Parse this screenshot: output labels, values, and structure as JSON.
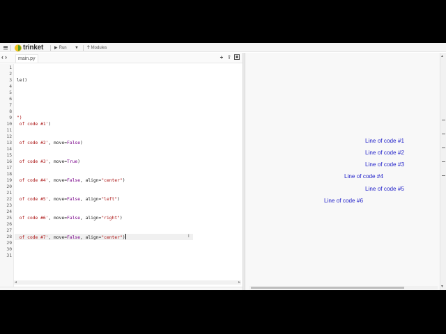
{
  "toolbar": {
    "menu_icon": "hamburger-icon",
    "logo_text": "trinket",
    "run_label": "Run",
    "run_icon": "play-icon",
    "dropdown_icon": "caret-down-icon",
    "modules_label": "Modules",
    "modules_icon": "question-icon"
  },
  "tabs": {
    "back_icon": "chevron-left-icon",
    "forward_icon": "chevron-right-icon",
    "file_name": "main.py",
    "add_icon": "plus-icon",
    "upload_icon": "upload-icon",
    "image_icon": "image-icon"
  },
  "editor": {
    "line_numbers": [
      "1",
      "2",
      "3",
      "4",
      "5",
      "6",
      "7",
      "8",
      "9",
      "10",
      "11",
      "12",
      "13",
      "14",
      "15",
      "16",
      "17",
      "18",
      "19",
      "20",
      "21",
      "22",
      "23",
      "24",
      "25",
      "26",
      "27",
      "28",
      "29",
      "30",
      "31"
    ],
    "lines": {
      "l3": "le()",
      "l9": "\")",
      "l10": {
        "s1": " of code #1'",
        "t": ")"
      },
      "l13": {
        "s1": " of code #2'",
        "t1": ", move=",
        "k1": "False",
        "t2": ")"
      },
      "l16": {
        "s1": " of code #3'",
        "t1": ", move=",
        "k1": "True",
        "t2": ")"
      },
      "l19": {
        "s1": " of code #4'",
        "t1": ", move=",
        "k1": "False",
        "t2": ", align=",
        "s2": "\"center\"",
        "t3": ")"
      },
      "l22": {
        "s1": " of code #5'",
        "t1": ", move=",
        "k1": "False",
        "t2": ", align=",
        "s2": "\"left\"",
        "t3": ")"
      },
      "l25": {
        "s1": " of code #6'",
        "t1": ", move=",
        "k1": "False",
        "t2": ", align=",
        "s2": "\"right\"",
        "t3": ")"
      },
      "l28": {
        "s1": " of code #7'",
        "t1": ", move=",
        "k1": "False",
        "t2": ", align=",
        "s2": "\"center\"",
        "t3": ")"
      }
    }
  },
  "output": {
    "text_color": "#1f1fc9",
    "lines": [
      "Line of code #1",
      "Line of code #2",
      "Line of code #3",
      "Line of code #4",
      "Line of code #5",
      "Line of code #6"
    ]
  },
  "colors": {
    "string": "#aa1111",
    "keyword": "#770088"
  }
}
